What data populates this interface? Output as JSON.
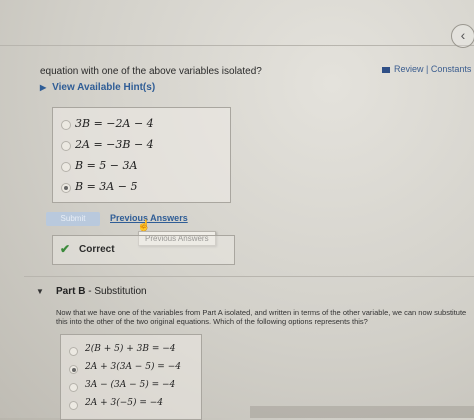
{
  "part_a": {
    "question": "equation with one of the above variables isolated?",
    "review_link": "Review | Constants | Pe",
    "hint_link": "View Available Hint(s)",
    "choices": [
      {
        "text": "3B = −2A − 4",
        "selected": false
      },
      {
        "text": "2A = −3B − 4",
        "selected": false
      },
      {
        "text": "B = 5 − 3A",
        "selected": false
      },
      {
        "text": "B = 3A − 5",
        "selected": true
      }
    ],
    "submit_label": "Submit",
    "previous_answers_label": "Previous Answers",
    "tooltip": "Previous Answers",
    "feedback": "Correct"
  },
  "part_b": {
    "title_prefix": "Part B",
    "title_suffix": " - Substitution",
    "description": "Now that we have one of the variables from Part A isolated, and written in terms of the other variable, we can now substitute this into the other of the two original equations. Which of the following options represents this?",
    "choices": [
      {
        "text": "2(B + 5) + 3B = −4",
        "selected": false
      },
      {
        "text": "2A + 3(3A − 5) = −4",
        "selected": true
      },
      {
        "text": "3A − (3A − 5) = −4",
        "selected": false
      },
      {
        "text": "2A + 3(−5) = −4",
        "selected": false
      }
    ]
  },
  "icons": {
    "back": "chevron-left-icon",
    "review": "review-icon",
    "hint": "caret-right-icon",
    "correct": "check-icon",
    "part_b": "caret-down-icon",
    "cursor": "hand-cursor-icon"
  },
  "colors": {
    "link": "#2f5d96",
    "correct": "#3b8a3b",
    "submit_bg": "#b9c9dd"
  }
}
